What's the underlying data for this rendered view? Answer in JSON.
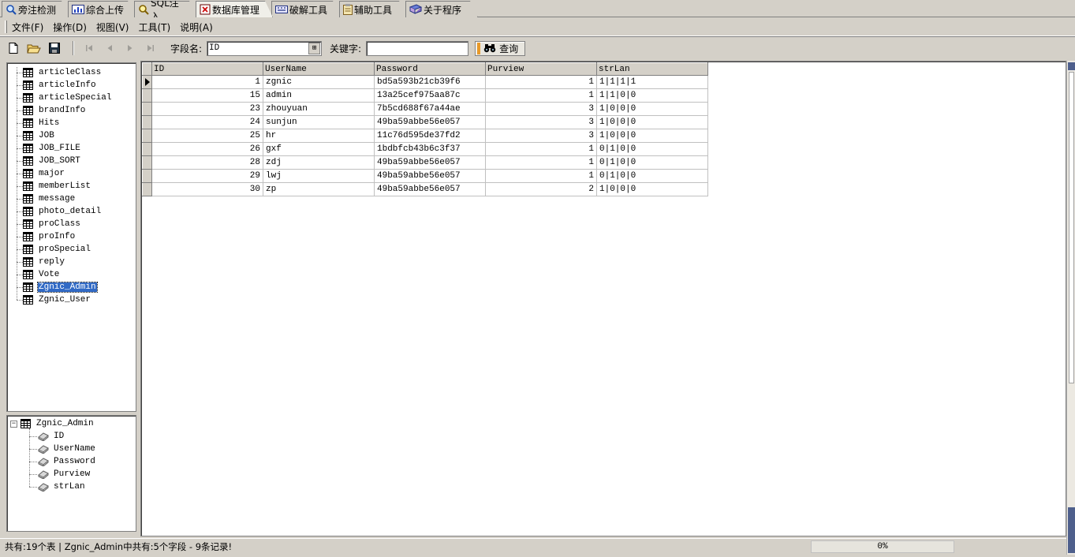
{
  "tabs": [
    {
      "label": "旁注检测",
      "icon": "magnifier-icon"
    },
    {
      "label": "综合上传",
      "icon": "chart-icon"
    },
    {
      "label": "SQL注入",
      "icon": "magnifier-db-icon"
    },
    {
      "label": "数据库管理",
      "icon": "database-icon",
      "active": true
    },
    {
      "label": "破解工具",
      "icon": "keyboard-icon"
    },
    {
      "label": "辅助工具",
      "icon": "clipboard-icon"
    },
    {
      "label": "关于程序",
      "icon": "book-icon"
    }
  ],
  "menu": [
    "文件(F)",
    "操作(D)",
    "视图(V)",
    "工具(T)",
    "说明(A)"
  ],
  "toolbar": {
    "field_label": "字段名:",
    "field_value": "ID",
    "keyword_label": "关键字:",
    "keyword_value": "",
    "query_label": "查询"
  },
  "tables": [
    "articleClass",
    "articleInfo",
    "articleSpecial",
    "brandInfo",
    "Hits",
    "JOB",
    "JOB_FILE",
    "JOB_SORT",
    "major",
    "memberList",
    "message",
    "photo_detail",
    "proClass",
    "proInfo",
    "proSpecial",
    "reply",
    "Vote",
    "Zgnic_Admin",
    "Zgnic_User"
  ],
  "selected_table": "Zgnic_Admin",
  "field_tree": {
    "root": "Zgnic_Admin",
    "fields": [
      "ID",
      "UserName",
      "Password",
      "Purview",
      "strLan"
    ]
  },
  "grid": {
    "columns": [
      "ID",
      "UserName",
      "Password",
      "Purview",
      "strLan"
    ],
    "rows": [
      [
        "1",
        "zgnic",
        "bd5a593b21cb39f6",
        "1",
        "1|1|1|1"
      ],
      [
        "15",
        "admin",
        "13a25cef975aa87c",
        "1",
        "1|1|0|0"
      ],
      [
        "23",
        "zhouyuan",
        "7b5cd688f67a44ae",
        "3",
        "1|0|0|0"
      ],
      [
        "24",
        "sunjun",
        "49ba59abbe56e057",
        "3",
        "1|0|0|0"
      ],
      [
        "25",
        "hr",
        "11c76d595de37fd2",
        "3",
        "1|0|0|0"
      ],
      [
        "26",
        "gxf",
        "1bdbfcb43b6c3f37",
        "1",
        "0|1|0|0"
      ],
      [
        "28",
        "zdj",
        "49ba59abbe56e057",
        "1",
        "0|1|0|0"
      ],
      [
        "29",
        "lwj",
        "49ba59abbe56e057",
        "1",
        "0|1|0|0"
      ],
      [
        "30",
        "zp",
        "49ba59abbe56e057",
        "2",
        "1|0|0|0"
      ]
    ]
  },
  "status": {
    "text": "共有:19个表 | Zgnic_Admin中共有:5个字段 - 9条记录!",
    "progress": "0%"
  },
  "colors": {
    "face": "#d4d0c8",
    "selection": "#316ac5"
  }
}
